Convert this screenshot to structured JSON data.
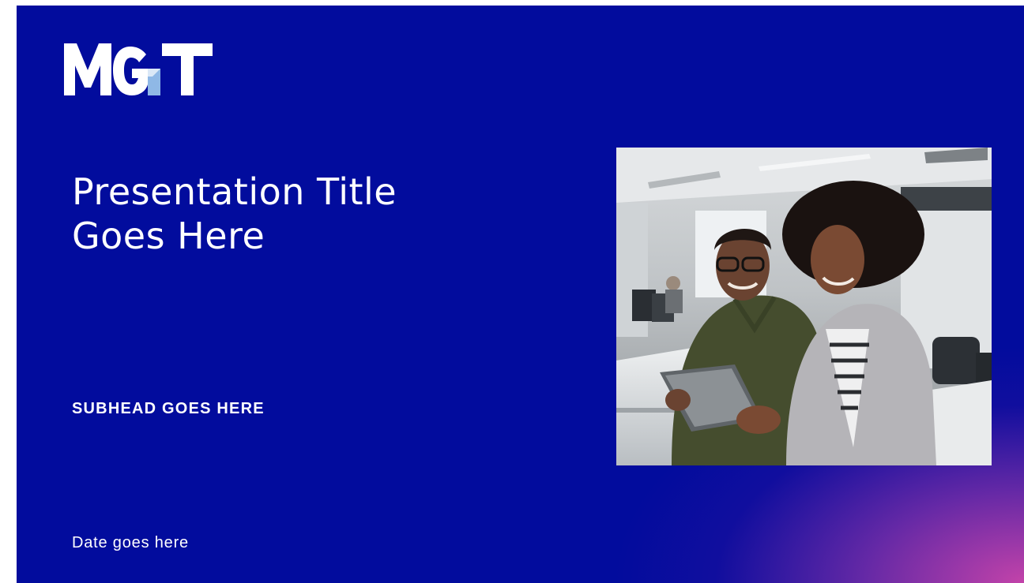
{
  "slide": {
    "logo_text": "MGT",
    "title_lines": [
      "Presentation Title",
      "Goes Here"
    ],
    "subhead": "SUBHEAD GOES HERE",
    "date": "Date goes here",
    "photo_alt": "",
    "colors": {
      "background": "#020c9d",
      "gradient_corner": "#c946aa",
      "text": "#ffffff",
      "logo_accent": "#8fb8e6"
    }
  }
}
